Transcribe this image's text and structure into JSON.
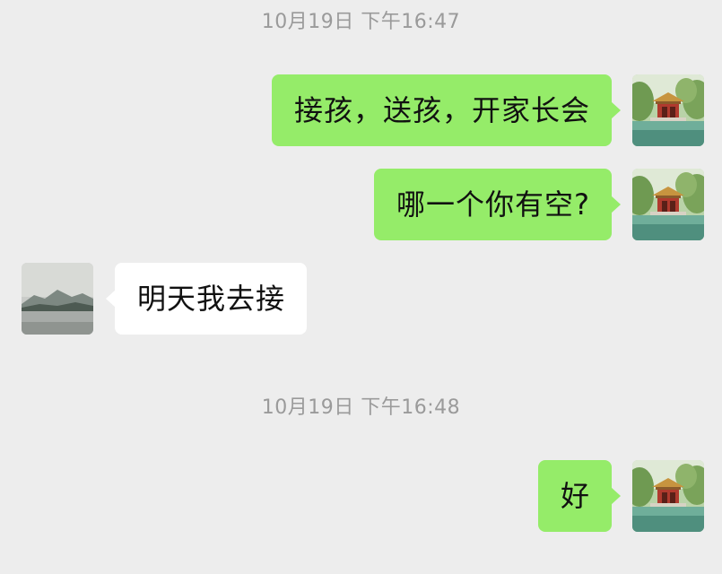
{
  "timestamps": [
    "10月19日 下午16:47",
    "10月19日 下午16:48"
  ],
  "messages": [
    {
      "side": "sent",
      "text": "接孩，送孩，开家长会"
    },
    {
      "side": "sent",
      "text": "哪一个你有空?"
    },
    {
      "side": "received",
      "text": "明天我去接"
    },
    {
      "side": "sent",
      "text": "好"
    }
  ],
  "avatars": {
    "self": "pavilion-landscape-avatar",
    "contact": "lake-mountain-avatar"
  },
  "colors": {
    "background": "#ededed",
    "sent_bubble": "#95ec69",
    "received_bubble": "#ffffff",
    "timestamp_text": "#9a9a9a"
  }
}
